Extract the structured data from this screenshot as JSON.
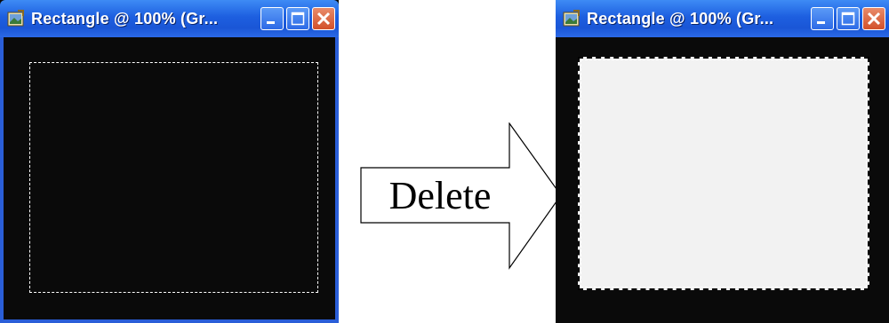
{
  "left_window": {
    "title": "Rectangle @ 100% (Gr...",
    "icons": [
      "app-icon",
      "minimize-icon",
      "maximize-icon",
      "close-icon"
    ]
  },
  "right_window": {
    "title": "Rectangle @ 100% (Gr...",
    "icons": [
      "app-icon",
      "minimize-icon",
      "maximize-icon",
      "close-icon"
    ]
  },
  "arrow": {
    "label": "Delete"
  },
  "colors": {
    "titlebar": "#1d5fe0",
    "canvas_black": "#0a0a0a",
    "selection_fill": "#f2f2f2",
    "close_button": "#d2502a"
  }
}
